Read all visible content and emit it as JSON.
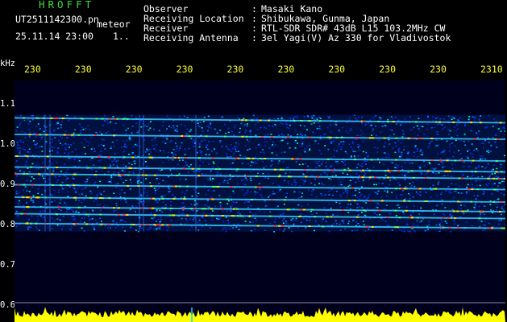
{
  "header": {
    "app_title": "HROFFT",
    "file_name": "UT2511142300.pn",
    "mode": "meteor",
    "date_time": "25.11.14 23:00",
    "date_extra": "1.."
  },
  "info": [
    {
      "label": "Observer",
      "value": "Masaki Kano"
    },
    {
      "label": "Receiving Location",
      "value": "Shibukawa, Gunma, Japan"
    },
    {
      "label": "Receiver",
      "value": "RTL-SDR SDR# 43dB L15 103.2MHz CW"
    },
    {
      "label": "Receiving Antenna",
      "value": "3el Yagi(V) Az 330 for Vladivostok"
    }
  ],
  "chart_data": {
    "type": "heatmap",
    "ylabel": "kHz",
    "y_ticks": [
      "1.1",
      "1.0",
      "0.9",
      "0.8",
      "0.7",
      "0.6"
    ],
    "ylim": [
      0.6,
      1.1
    ],
    "x_ticks": [
      "230",
      "230",
      "230",
      "230",
      "230",
      "230",
      "230",
      "230",
      "230",
      "2310"
    ],
    "traces_khz": [
      1.067,
      1.026,
      0.972,
      0.945,
      0.928,
      0.901,
      0.87,
      0.846,
      0.829,
      0.805
    ],
    "baseline_khz": 0.608
  },
  "colors": {
    "title": "#3ddc3d",
    "tick": "#ffff33",
    "background": "#00001c",
    "noise_floor": "#ffff00"
  }
}
